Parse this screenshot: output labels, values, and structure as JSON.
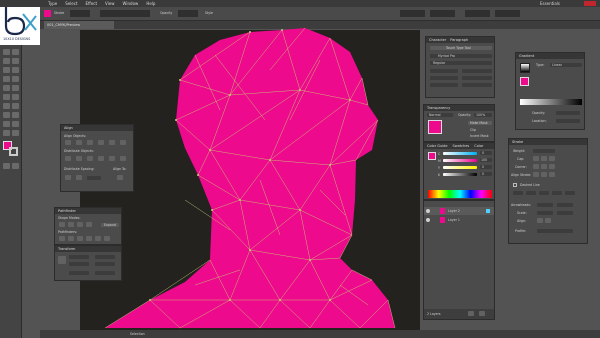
{
  "menu": [
    "Type",
    "Select",
    "Effect",
    "View",
    "Window",
    "Help"
  ],
  "document_tab": "001_CMYK/Preview",
  "workspace": "Essentials",
  "logo": {
    "text": "10X10 DESIGNS"
  },
  "control_bar": {
    "stroke_label": "Stroke",
    "opacity_label": "Opacity",
    "style_label": "Style"
  },
  "panels": {
    "align": {
      "title": "Align",
      "align_objects": "Align Objects:",
      "distribute_objects": "Distribute Objects:",
      "distribute_spacing": "Distribute Spacing:",
      "align_to": "Align To:"
    },
    "pathfinder": {
      "title": "Pathfinder",
      "shape_modes": "Shape Modes:",
      "pathfinders": "Pathfinders:",
      "expand": "Expand"
    },
    "transform": {
      "title": "Transform"
    },
    "character": {
      "title": "Character",
      "paragraph": "Paragraph",
      "touch_type": "Touch Type Tool",
      "font_name": "Myriad Pro",
      "font_style": "Regular"
    },
    "transparency": {
      "title": "Transparency",
      "mode": "Normal",
      "opacity_label": "Opacity:",
      "opacity": "100%",
      "make_mask": "Make Mask",
      "clip": "Clip",
      "invert_mask": "Invert Mask"
    },
    "color": {
      "tabs": [
        "Color Guide",
        "Swatches",
        "Color"
      ],
      "channels": [
        "C",
        "M",
        "Y",
        "K"
      ],
      "values": [
        "0",
        "100",
        "0",
        "0"
      ]
    },
    "layers": {
      "items": [
        "Layer 2",
        "Layer 1"
      ],
      "footer": "2 Layers"
    },
    "gradient": {
      "title": "Gradient",
      "type": "Type:",
      "type_value": "Linear",
      "opacity_label": "Opacity:",
      "location_label": "Location:"
    },
    "stroke": {
      "title": "Stroke",
      "weight_label": "Weight:",
      "cap_label": "Cap:",
      "corner_label": "Corner:",
      "align_label": "Align Stroke:",
      "dashed_line": "Dashed Line",
      "arrowheads": "Arrowheads:",
      "scale": "Scale:",
      "align": "Align:",
      "profile": "Profile:"
    }
  },
  "colors": {
    "fill": "#ee0a8c",
    "artwork": "#ee0a8c",
    "mesh": "#c5c875"
  },
  "status": "Selection"
}
